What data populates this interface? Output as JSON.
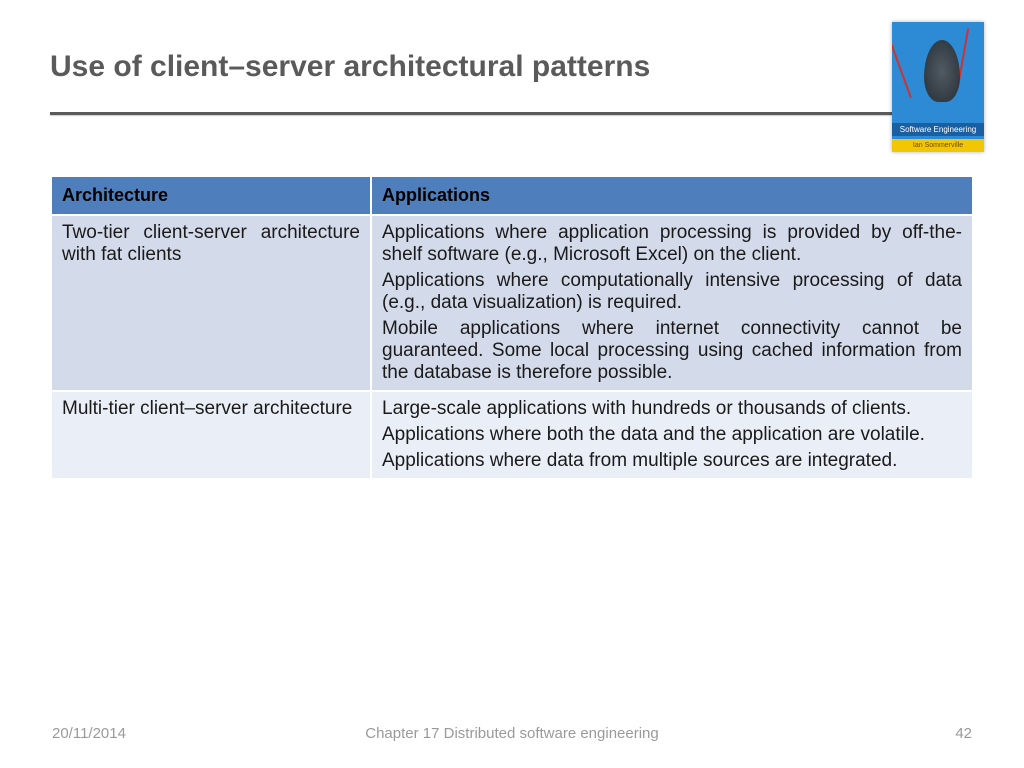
{
  "header": {
    "title": "Use of client–server architectural patterns"
  },
  "book": {
    "series_label": "Software Engineering",
    "author_label": "Ian Sommerville"
  },
  "table": {
    "headers": {
      "architecture": "Architecture",
      "applications": "Applications"
    },
    "rows": [
      {
        "architecture": "Two-tier client-server architecture with fat clients",
        "applications": [
          "Applications where application processing is provided by off-the-shelf software (e.g., Microsoft Excel) on the client.",
          "Applications where computationally intensive processing of data (e.g., data visualization) is required.",
          "Mobile applications where internet connectivity cannot be guaranteed. Some local processing using cached information from the database is therefore possible."
        ]
      },
      {
        "architecture": "Multi-tier client–server architecture",
        "applications": [
          "Large-scale applications with hundreds or thousands of clients.",
          "Applications where both the data and the application are volatile.",
          "Applications where data from multiple sources are integrated."
        ]
      }
    ]
  },
  "footer": {
    "date": "20/11/2014",
    "chapter": "Chapter 17 Distributed software engineering",
    "page": "42"
  }
}
